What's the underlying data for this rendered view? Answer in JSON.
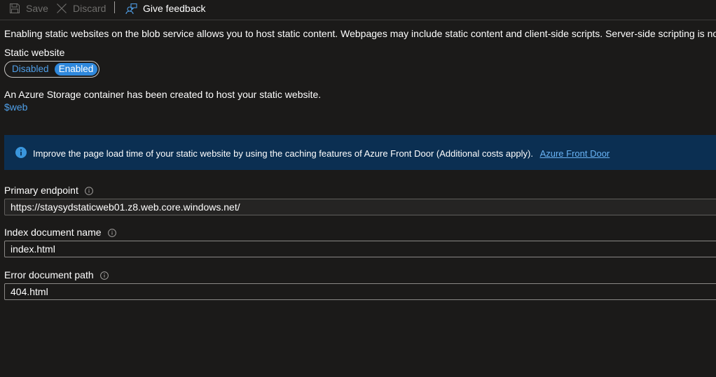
{
  "toolbar": {
    "save_label": "Save",
    "discard_label": "Discard",
    "feedback_label": "Give feedback"
  },
  "description": "Enabling static websites on the blob service allows you to host static content. Webpages may include static content and client-side scripts. Server-side scripting is not supported. A",
  "static_website": {
    "label": "Static website",
    "options": [
      "Disabled",
      "Enabled"
    ],
    "selected": "Enabled"
  },
  "container_message": "An Azure Storage container has been created to host your static website.",
  "container_link": "$web",
  "info_bar": {
    "text": "Improve the page load time of your static website by using the caching features of Azure Front Door (Additional costs apply).",
    "link": "Azure Front Door"
  },
  "fields": {
    "primary_endpoint": {
      "label": "Primary endpoint",
      "value": "https://staysydstaticweb01.z8.web.core.windows.net/"
    },
    "index_document": {
      "label": "Index document name",
      "value": "index.html"
    },
    "error_document": {
      "label": "Error document path",
      "value": "404.html"
    }
  },
  "colors": {
    "background": "#1b1a19",
    "accent": "#2f88dc",
    "link": "#4f9fe8",
    "info_bar": "#0b2f52"
  },
  "icons": [
    "save-icon",
    "discard-icon",
    "feedback-icon",
    "info-icon",
    "help-icon"
  ]
}
